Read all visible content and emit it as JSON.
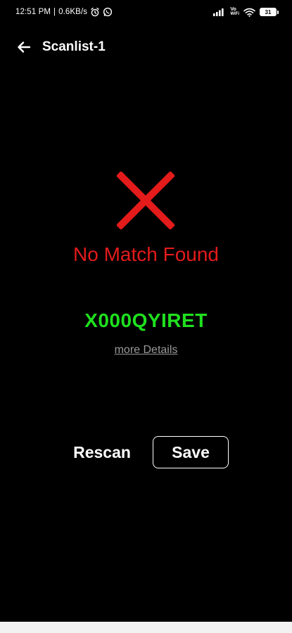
{
  "status_bar": {
    "time": "12:51 PM",
    "separator": "|",
    "net_speed": "0.6KB/s",
    "volte": "Vo",
    "wifi_label": "WiFi",
    "battery": "31"
  },
  "app_bar": {
    "title": "Scanlist-1",
    "back_icon": "arrow-left-icon"
  },
  "result": {
    "status_icon": "close-icon",
    "status_color": "#e31b1b",
    "message": "No Match Found",
    "code": "X000QYIRET",
    "code_color": "#1fe01f",
    "details_link": "more Details"
  },
  "actions": {
    "rescan_label": "Rescan",
    "save_label": "Save"
  }
}
